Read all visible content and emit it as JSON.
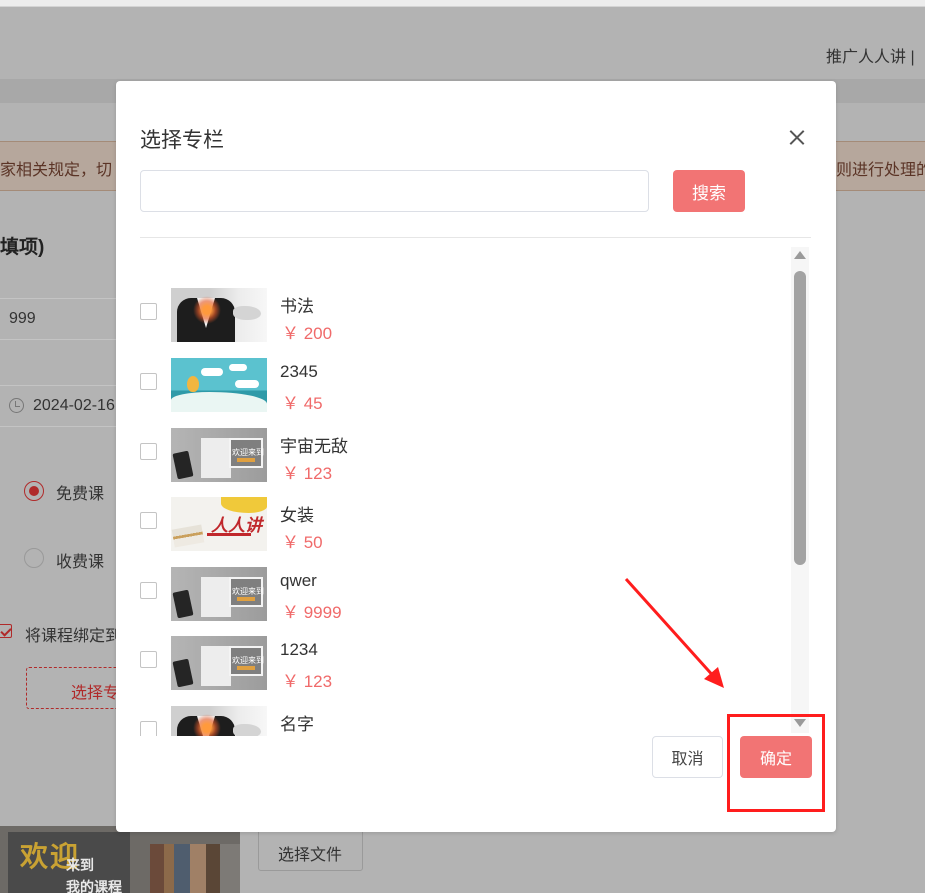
{
  "header": {
    "link_text": "推广人人讲 |"
  },
  "notice": {
    "left_text": "家相关规定，切",
    "right_text": "则进行处理的"
  },
  "form": {
    "section_title": "填项)",
    "price_value": "999",
    "date_value": "2024-02-16",
    "radio_free_label": "免费课",
    "radio_paid_label": "收费课",
    "bind_label": "将课程绑定到",
    "choose_column_label": "选择专",
    "choose_file_label": "选择文件",
    "cover": {
      "big_text": "欢迎",
      "small_text": "来到\n我的课程"
    }
  },
  "dialog": {
    "title": "选择专栏",
    "search": {
      "value": "",
      "placeholder": "",
      "button_label": "搜索"
    },
    "currency": "￥",
    "items": [
      {
        "name": "书法",
        "price": "￥ 200",
        "thumb": "suit-icon",
        "checked": false
      },
      {
        "name": "2345",
        "price": "￥ 45",
        "thumb": "sky-balloon-icon",
        "checked": false
      },
      {
        "name": "宇宙无敌",
        "price": "￥ 123",
        "thumb": "desk-welcome-icon",
        "checked": false
      },
      {
        "name": "女装",
        "price": "￥ 50",
        "thumb": "renrenjiang-logo-icon",
        "checked": false
      },
      {
        "name": "qwer",
        "price": "￥ 9999",
        "thumb": "desk-welcome-icon",
        "checked": false
      },
      {
        "name": "1234",
        "price": "￥ 123",
        "thumb": "desk-welcome-icon",
        "checked": false
      },
      {
        "name": "名字",
        "price": "",
        "thumb": "suit-icon",
        "checked": false
      }
    ],
    "thumb_text": {
      "welcome": "欢迎来到",
      "logo": "人人讲"
    },
    "cancel_label": "取消",
    "ok_label": "确定"
  },
  "colors": {
    "accent": "#f27474",
    "price": "#f06a6a",
    "overlay": "#b3b3b3",
    "annotation": "#ff1d1d"
  }
}
